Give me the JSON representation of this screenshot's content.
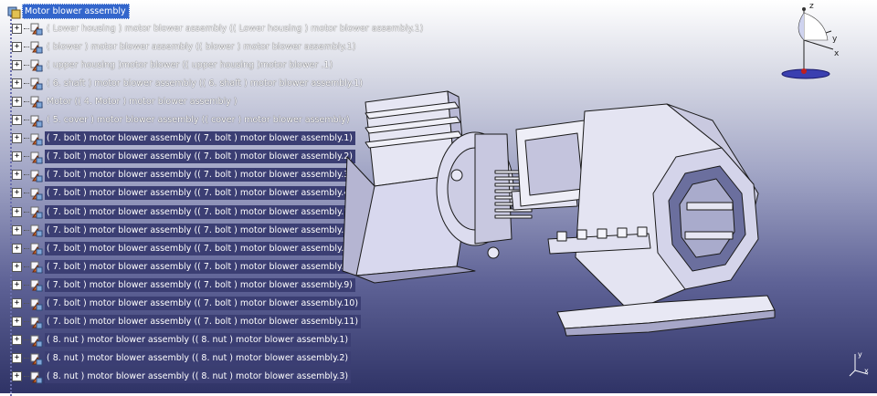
{
  "tree": {
    "root": {
      "label": "Motor blower assembly"
    },
    "items": [
      {
        "label": "( Lower housing ) motor blower assembly (( Lower housing ) motor blower assembly.1)",
        "highlight": false
      },
      {
        "label": "( blower ) motor blower assembly (( blower ) motor blower assembly.1)",
        "highlight": false
      },
      {
        "label": "( upper housing )motor blower  (( upper housing )motor blower .1)",
        "highlight": false
      },
      {
        "label": "( 6. shaft ) motor blower assembly (( 6. shaft ) motor blower assembly.1)",
        "highlight": false
      },
      {
        "label": "Motor (( 4. Motor ) motor blower assembly )",
        "highlight": false
      },
      {
        "label": "( 5.  cover ) motor blower assembly (( cover ) motor blower assembly)",
        "highlight": false
      },
      {
        "label": "( 7. bolt ) motor blower assembly (( 7. bolt ) motor blower assembly.1)",
        "highlight": true
      },
      {
        "label": "( 7. bolt ) motor blower assembly (( 7. bolt ) motor blower assembly.2)",
        "highlight": true
      },
      {
        "label": "( 7. bolt ) motor blower assembly (( 7. bolt ) motor blower assembly.3)",
        "highlight": true
      },
      {
        "label": "( 7. bolt ) motor blower assembly (( 7. bolt ) motor blower assembly.4)",
        "highlight": true
      },
      {
        "label": "( 7. bolt ) motor blower assembly (( 7. bolt ) motor blower assembly.5)",
        "highlight": true
      },
      {
        "label": "( 7. bolt ) motor blower assembly (( 7. bolt ) motor blower assembly.6)",
        "highlight": true
      },
      {
        "label": "( 7. bolt ) motor blower assembly (( 7. bolt ) motor blower assembly.7)",
        "highlight": true
      },
      {
        "label": "( 7. bolt ) motor blower assembly (( 7. bolt ) motor blower assembly.8)",
        "highlight": true
      },
      {
        "label": "( 7. bolt ) motor blower assembly (( 7. bolt ) motor blower assembly.9)",
        "highlight": true
      },
      {
        "label": "( 7. bolt ) motor blower assembly (( 7. bolt ) motor blower assembly.10)",
        "highlight": true
      },
      {
        "label": "( 7. bolt ) motor blower assembly (( 7. bolt ) motor blower assembly.11)",
        "highlight": true
      },
      {
        "label": "( 8. nut ) motor blower assembly (( 8. nut ) motor blower assembly.1)",
        "highlight": true
      },
      {
        "label": "( 8. nut ) motor blower assembly (( 8. nut ) motor blower assembly.2)",
        "highlight": true
      },
      {
        "label": "( 8. nut ) motor blower assembly (( 8. nut ) motor blower assembly.3)",
        "highlight": true
      }
    ],
    "expander_symbol": "+"
  },
  "compass": {
    "axis_z": "z",
    "axis_y": "y",
    "axis_x": "x"
  },
  "mini_axis": {
    "axis_y": "y",
    "axis_x": "x"
  },
  "colors": {
    "selection": "#3366cc",
    "label_background": "#3b3e73",
    "model_fill": "#d8d8ee",
    "model_stroke": "#1a1a1a"
  }
}
